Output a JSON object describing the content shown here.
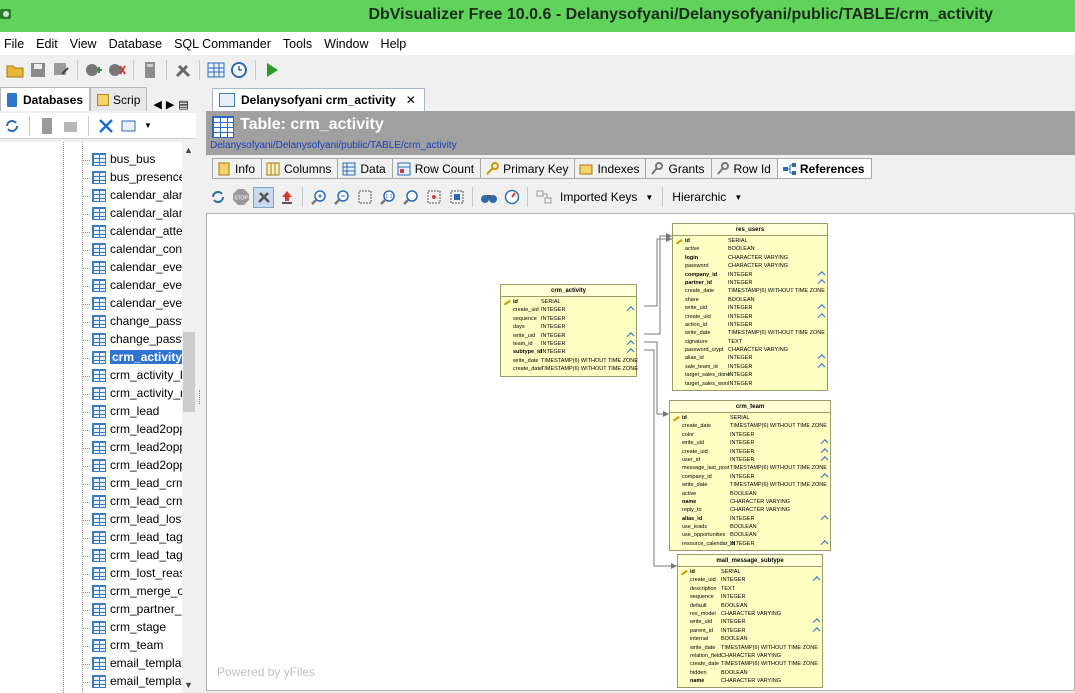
{
  "window": {
    "title": "DbVisualizer Free 10.0.6 - Delanysofyani/Delanysofyani/public/TABLE/crm_activity"
  },
  "menu": [
    "File",
    "Edit",
    "View",
    "Database",
    "SQL Commander",
    "Tools",
    "Window",
    "Help"
  ],
  "left_panel": {
    "tabs": [
      {
        "label": "Databases"
      },
      {
        "label": "Scrip"
      }
    ],
    "tree_items": [
      "bus_bus",
      "bus_presence",
      "calendar_alarr",
      "calendar_alarr",
      "calendar_atter",
      "calendar_cont",
      "calendar_ever",
      "calendar_ever",
      "calendar_ever",
      "change_passw",
      "change_passw",
      "crm_activity",
      "crm_activity_l",
      "crm_activity_r",
      "crm_lead",
      "crm_lead2oppo",
      "crm_lead2oppo",
      "crm_lead2oppo",
      "crm_lead_crm_",
      "crm_lead_crm_",
      "crm_lead_lost",
      "crm_lead_tag",
      "crm_lead_tag_",
      "crm_lost_reaso",
      "crm_merge_op",
      "crm_partner_b",
      "crm_stage",
      "crm_team",
      "email_template",
      "email_template"
    ],
    "selected_item": "crm_activity"
  },
  "document": {
    "tab_label": "Delanysofyani crm_activity",
    "header_title": "Table: crm_activity",
    "header_path": "Delanysofyani/Delanysofyani/public/TABLE/crm_activity",
    "subtabs": [
      "Info",
      "Columns",
      "Data",
      "Row Count",
      "Primary Key",
      "Indexes",
      "Grants",
      "Row Id",
      "References"
    ],
    "active_subtab": "References",
    "keys_combo": "Imported Keys",
    "layout_combo": "Hierarchic",
    "powered_by": "Powered by yFiles"
  },
  "diagram": {
    "tables": [
      {
        "name": "crm_activity",
        "columns": [
          {
            "name": "id",
            "type": "SERIAL",
            "pk": true,
            "fk": false
          },
          {
            "name": "create_uid",
            "type": "INTEGER",
            "pk": false,
            "fk": true
          },
          {
            "name": "sequence",
            "type": "INTEGER",
            "pk": false,
            "fk": false
          },
          {
            "name": "days",
            "type": "INTEGER",
            "pk": false,
            "fk": false
          },
          {
            "name": "write_uid",
            "type": "INTEGER",
            "pk": false,
            "fk": true
          },
          {
            "name": "team_id",
            "type": "INTEGER",
            "pk": false,
            "fk": true
          },
          {
            "name": "subtype_id",
            "type": "INTEGER",
            "pk": false,
            "fk": true,
            "bold": true
          },
          {
            "name": "write_date",
            "type": "TIMESTAMP(6) WITHOUT TIME ZONE",
            "pk": false,
            "fk": false
          },
          {
            "name": "create_date",
            "type": "TIMESTAMP(6) WITHOUT TIME ZONE",
            "pk": false,
            "fk": false
          }
        ]
      },
      {
        "name": "res_users",
        "columns": [
          {
            "name": "id",
            "type": "SERIAL",
            "pk": true,
            "fk": false
          },
          {
            "name": "active",
            "type": "BOOLEAN",
            "pk": false,
            "fk": false
          },
          {
            "name": "login",
            "type": "CHARACTER VARYING",
            "pk": false,
            "fk": false,
            "bold": true
          },
          {
            "name": "password",
            "type": "CHARACTER VARYING",
            "pk": false,
            "fk": false
          },
          {
            "name": "company_id",
            "type": "INTEGER",
            "pk": false,
            "fk": true,
            "bold": true
          },
          {
            "name": "partner_id",
            "type": "INTEGER",
            "pk": false,
            "fk": true,
            "bold": true
          },
          {
            "name": "create_date",
            "type": "TIMESTAMP(6) WITHOUT TIME ZONE",
            "pk": false,
            "fk": false
          },
          {
            "name": "share",
            "type": "BOOLEAN",
            "pk": false,
            "fk": false
          },
          {
            "name": "write_uid",
            "type": "INTEGER",
            "pk": false,
            "fk": true
          },
          {
            "name": "create_uid",
            "type": "INTEGER",
            "pk": false,
            "fk": true
          },
          {
            "name": "action_id",
            "type": "INTEGER",
            "pk": false,
            "fk": false
          },
          {
            "name": "write_date",
            "type": "TIMESTAMP(6) WITHOUT TIME ZONE",
            "pk": false,
            "fk": false
          },
          {
            "name": "signature",
            "type": "TEXT",
            "pk": false,
            "fk": false
          },
          {
            "name": "password_crypt",
            "type": "CHARACTER VARYING",
            "pk": false,
            "fk": false
          },
          {
            "name": "alias_id",
            "type": "INTEGER",
            "pk": false,
            "fk": true
          },
          {
            "name": "sale_team_id",
            "type": "INTEGER",
            "pk": false,
            "fk": true
          },
          {
            "name": "target_sales_done",
            "type": "INTEGER",
            "pk": false,
            "fk": false
          },
          {
            "name": "target_sales_won",
            "type": "INTEGER",
            "pk": false,
            "fk": false
          }
        ]
      },
      {
        "name": "crm_team",
        "columns": [
          {
            "name": "id",
            "type": "SERIAL",
            "pk": true,
            "fk": false
          },
          {
            "name": "create_date",
            "type": "TIMESTAMP(6) WITHOUT TIME ZONE",
            "pk": false,
            "fk": false
          },
          {
            "name": "color",
            "type": "INTEGER",
            "pk": false,
            "fk": false
          },
          {
            "name": "write_uid",
            "type": "INTEGER",
            "pk": false,
            "fk": true
          },
          {
            "name": "create_uid",
            "type": "INTEGER",
            "pk": false,
            "fk": true
          },
          {
            "name": "user_id",
            "type": "INTEGER",
            "pk": false,
            "fk": true
          },
          {
            "name": "message_last_post",
            "type": "TIMESTAMP(6) WITHOUT TIME ZONE",
            "pk": false,
            "fk": false
          },
          {
            "name": "company_id",
            "type": "INTEGER",
            "pk": false,
            "fk": true
          },
          {
            "name": "write_date",
            "type": "TIMESTAMP(6) WITHOUT TIME ZONE",
            "pk": false,
            "fk": false
          },
          {
            "name": "active",
            "type": "BOOLEAN",
            "pk": false,
            "fk": false
          },
          {
            "name": "name",
            "type": "CHARACTER VARYING",
            "pk": false,
            "fk": false,
            "bold": true
          },
          {
            "name": "reply_to",
            "type": "CHARACTER VARYING",
            "pk": false,
            "fk": false
          },
          {
            "name": "alias_id",
            "type": "INTEGER",
            "pk": false,
            "fk": true,
            "bold": true
          },
          {
            "name": "use_leads",
            "type": "BOOLEAN",
            "pk": false,
            "fk": false
          },
          {
            "name": "use_opportunities",
            "type": "BOOLEAN",
            "pk": false,
            "fk": false
          },
          {
            "name": "resource_calendar_id",
            "type": "INTEGER",
            "pk": false,
            "fk": true
          }
        ]
      },
      {
        "name": "mail_message_subtype",
        "columns": [
          {
            "name": "id",
            "type": "SERIAL",
            "pk": true,
            "fk": false
          },
          {
            "name": "create_uid",
            "type": "INTEGER",
            "pk": false,
            "fk": true
          },
          {
            "name": "description",
            "type": "TEXT",
            "pk": false,
            "fk": false
          },
          {
            "name": "sequence",
            "type": "INTEGER",
            "pk": false,
            "fk": false
          },
          {
            "name": "default",
            "type": "BOOLEAN",
            "pk": false,
            "fk": false
          },
          {
            "name": "res_model",
            "type": "CHARACTER VARYING",
            "pk": false,
            "fk": false
          },
          {
            "name": "write_uid",
            "type": "INTEGER",
            "pk": false,
            "fk": true
          },
          {
            "name": "parent_id",
            "type": "INTEGER",
            "pk": false,
            "fk": true
          },
          {
            "name": "internal",
            "type": "BOOLEAN",
            "pk": false,
            "fk": false
          },
          {
            "name": "write_date",
            "type": "TIMESTAMP(6) WITHOUT TIME ZONE",
            "pk": false,
            "fk": false
          },
          {
            "name": "relation_field",
            "type": "CHARACTER VARYING",
            "pk": false,
            "fk": false
          },
          {
            "name": "create_date",
            "type": "TIMESTAMP(6) WITHOUT TIME ZONE",
            "pk": false,
            "fk": false
          },
          {
            "name": "hidden",
            "type": "BOOLEAN",
            "pk": false,
            "fk": false
          },
          {
            "name": "name",
            "type": "CHARACTER VARYING",
            "pk": false,
            "fk": false,
            "bold": true
          }
        ]
      }
    ]
  }
}
